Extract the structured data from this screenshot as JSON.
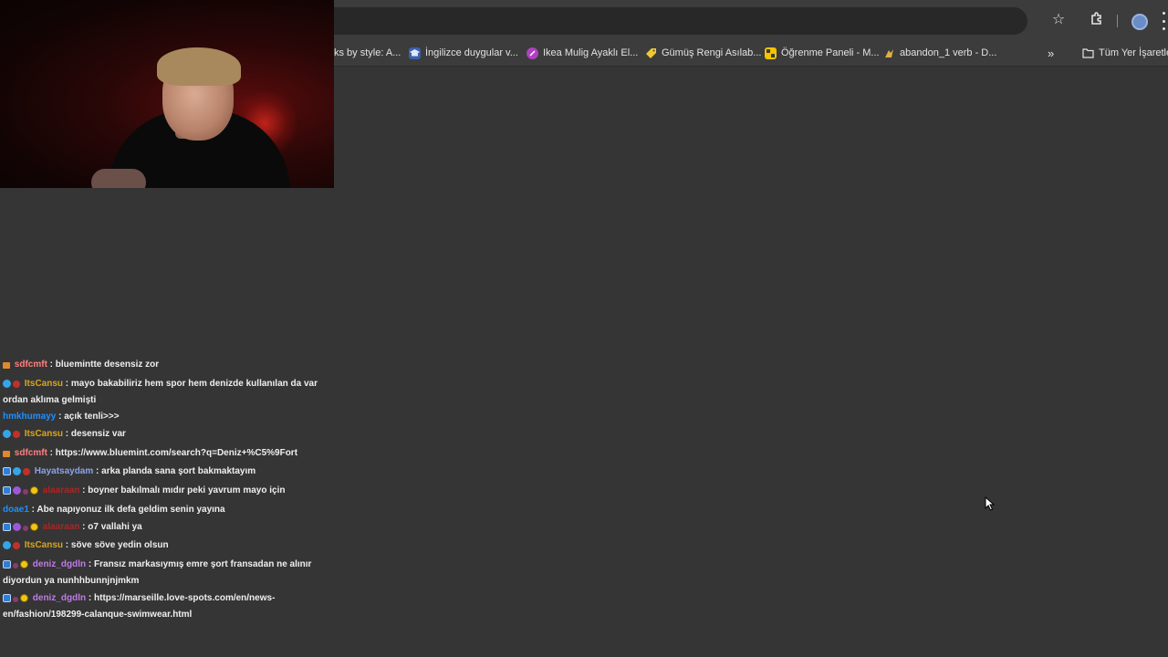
{
  "bookmarks": [
    {
      "label": "ks by style: A...",
      "icon": "none",
      "color": ""
    },
    {
      "label": "İngilizce duygular v...",
      "icon": "school-icon",
      "color": "#4a78c8"
    },
    {
      "label": "Ikea Mulig Ayaklı El...",
      "icon": "circle-icon",
      "color": "#b040c0"
    },
    {
      "label": "Gümüş Rengi Asılab...",
      "icon": "tag-icon",
      "color": "#f0c830"
    },
    {
      "label": "Öğrenme Paneli - M...",
      "icon": "grid-icon",
      "color": "#f5c400"
    },
    {
      "label": "abandon_1 verb - D...",
      "icon": "book-icon",
      "color": "#e0b040"
    },
    {
      "label": "Tüm Yer İşaretleri",
      "icon": "folder-icon",
      "color": ""
    }
  ],
  "bookmarks_overflow": "»",
  "toolbar": {
    "star_icon": "☆",
    "extensions_icon": "puzzle-icon"
  },
  "chat": {
    "messages": [
      {
        "badges": [
          "gift"
        ],
        "user": "sdfcmft",
        "user_color": "#ff7f7f",
        "text": "bluemintte desensiz zor"
      },
      {
        "badges": [
          "blue",
          "red"
        ],
        "user": "ItsCansu",
        "user_color": "#daa520",
        "text": "mayo bakabiliriz hem spor hem denizde kullanılan da var ordan aklıma gelmişti"
      },
      {
        "badges": [],
        "user": "hmkhumayy",
        "user_color": "#1e90ff",
        "text": "açık tenli>>>"
      },
      {
        "badges": [
          "blue",
          "red"
        ],
        "user": "ItsCansu",
        "user_color": "#daa520",
        "text": "desensiz var"
      },
      {
        "badges": [
          "gift"
        ],
        "user": "sdfcmft",
        "user_color": "#ff7f7f",
        "text": "https://www.bluemint.com/search?q=Deniz+%C5%9Fort"
      },
      {
        "badges": [
          "sub",
          "blue",
          "red"
        ],
        "user": "Hayatsaydam",
        "user_color": "#8aa4e8",
        "text": "arka planda sana şort bakmaktayım"
      },
      {
        "badges": [
          "sub",
          "purple",
          "dot",
          "gold"
        ],
        "user": "alaaraan",
        "user_color": "#b22222",
        "text": "boyner bakılmalı mıdır peki yavrum mayo için"
      },
      {
        "badges": [],
        "user": "doae1",
        "user_color": "#1e90ff",
        "text": "Abe napıyonuz ilk defa geldim senin yayına"
      },
      {
        "badges": [
          "sub",
          "purple",
          "dot",
          "gold"
        ],
        "user": "alaaraan",
        "user_color": "#b22222",
        "text": "o7 vallahi ya"
      },
      {
        "badges": [
          "blue",
          "red"
        ],
        "user": "ItsCansu",
        "user_color": "#daa520",
        "text": "söve söve yedin olsun"
      },
      {
        "badges": [
          "sub",
          "dot",
          "gold"
        ],
        "user": "deniz_dgdln",
        "user_color": "#c07ae8",
        "text": "Fransız markasıymış emre şort fransadan ne alınır diyordun ya nunhhbunnjnjmkm"
      },
      {
        "badges": [
          "sub",
          "dot",
          "gold"
        ],
        "user": "deniz_dgdln",
        "user_color": "#c07ae8",
        "text": "https://marseille.love-spots.com/en/news-en/fashion/198299-calanque-swimwear.html"
      }
    ]
  }
}
